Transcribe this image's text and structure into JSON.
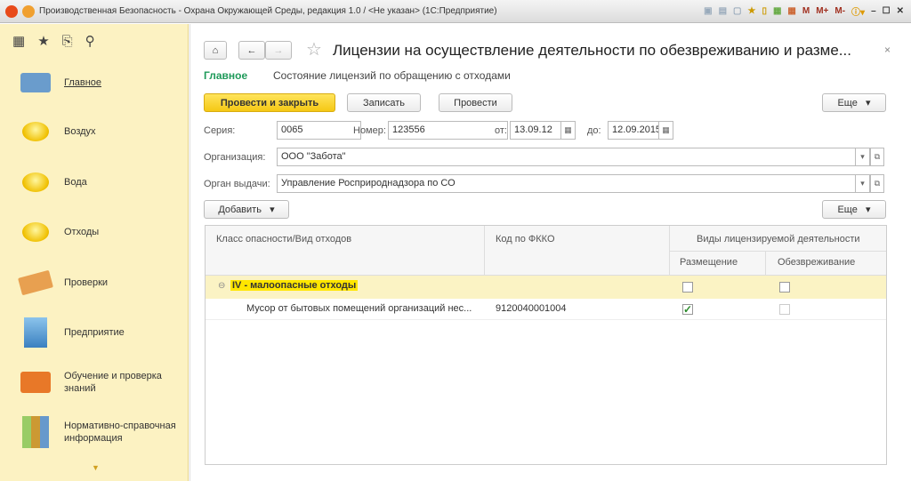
{
  "window": {
    "title": "Производственная Безопасность - Охрана Окружающей Среды, редакция 1.0 / <Не указан>  (1С:Предприятие)",
    "tools": [
      "M",
      "M+",
      "M-"
    ]
  },
  "sidebar": {
    "items": [
      {
        "label": "Главное"
      },
      {
        "label": "Воздух"
      },
      {
        "label": "Вода"
      },
      {
        "label": "Отходы"
      },
      {
        "label": "Проверки"
      },
      {
        "label": "Предприятие"
      },
      {
        "label": "Обучение и проверка знаний"
      },
      {
        "label": "Нормативно-справочная информация"
      }
    ]
  },
  "form": {
    "title": "Лицензии на осуществление деятельности по обезвреживанию и разме...",
    "tabs": [
      "Главное",
      "Состояние лицензий по обращению с отходами"
    ],
    "buttons": {
      "post_close": "Провести и закрыть",
      "save": "Записать",
      "post": "Провести",
      "more": "Еще",
      "add": "Добавить",
      "more2": "Еще"
    },
    "fields": {
      "series_label": "Серия:",
      "series": "0065",
      "number_label": "Номер:",
      "number": "123556",
      "from_label": "от:",
      "from": "13.09.12",
      "to_label": "до:",
      "to": "12.09.2015",
      "org_label": "Организация:",
      "org": "ООО \"Забота\"",
      "issuer_label": "Орган выдачи:",
      "issuer": "Управление Росприроднадзора по СО"
    }
  },
  "table": {
    "headers": {
      "class": "Класс опасности/Вид отходов",
      "code": "Код по ФККО",
      "activity": "Виды лицензируемой деятельности",
      "placement": "Размещение",
      "neutralization": "Обезвреживание"
    },
    "group": {
      "label": "IV - малоопасные отходы",
      "placement": false,
      "neutralization": false
    },
    "rows": [
      {
        "name": "Мусор от бытовых помещений организаций нес...",
        "code": "9120040001004",
        "placement": true,
        "neutralization": false
      }
    ]
  }
}
